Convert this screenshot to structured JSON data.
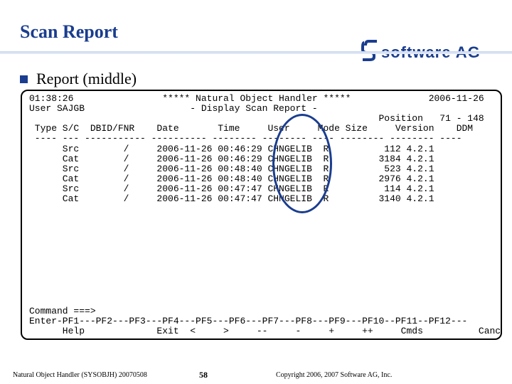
{
  "slide": {
    "title": "Scan Report",
    "bullet": "Report (middle)",
    "logo_text": "software AG"
  },
  "terminal": {
    "lines": [
      "01:38:26                ***** Natural Object Handler *****              2006-11-26",
      "User SAJGB                   - Display Scan Report -",
      "                                                               Position   71 - 148",
      " Type S/C  DBID/FNR    Date       Time     User     Mode Size     Version    DDM",
      " ---- --- ----------- ---------- -------- -------- ---- -------- -------- ----",
      "      Src        /     2006-11-26 00:46:29 CHNGELIB  R          112 4.2.1",
      "      Cat        /     2006-11-26 00:46:29 CHNGELIB  R         3184 4.2.1",
      "      Src        /     2006-11-26 00:48:40 CHNGELIB  R          523 4.2.1",
      "      Cat        /     2006-11-26 00:48:40 CHNGELIB  R         2976 4.2.1",
      "      Src        /     2006-11-26 00:47:47 CHNGELIB  R          114 4.2.1",
      "      Cat        /     2006-11-26 00:47:47 CHNGELIB  R         3140 4.2.1"
    ],
    "command_prompt": "Command ===>",
    "pf_keys": "Enter-PF1---PF2---PF3---PF4---PF5---PF6---PF7---PF8---PF9---PF10--PF11--PF12---",
    "pf_labels": "      Help             Exit  <     >     --     -     +     ++     Cmds          Canc"
  },
  "footer": {
    "left": "Natural Object Handler (SYSOBJH) 20070508",
    "page": "58",
    "copyright": "Copyright 2006, 2007 Software AG, Inc."
  },
  "colors": {
    "title": "#1a3d8f",
    "highlight": "#1a3d8f"
  }
}
